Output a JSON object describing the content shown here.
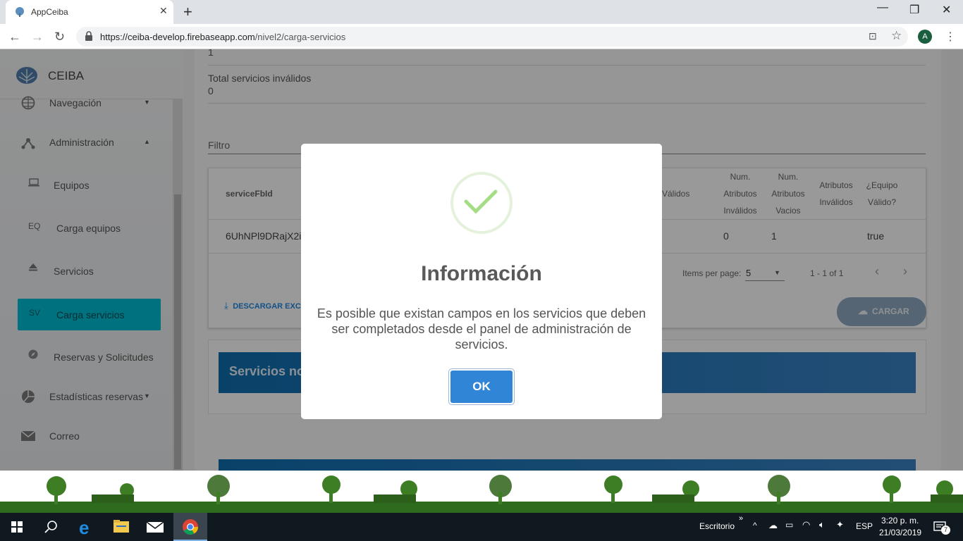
{
  "browser": {
    "tab_title": "AppCeiba",
    "url_host": "https://ceiba-develop.firebaseapp.com",
    "url_path": "/nivel2/carga-servicios",
    "avatar_letter": "A"
  },
  "sidebar": {
    "brand": "CEIBA",
    "items": [
      {
        "label": "Navegación",
        "icon": "globe-icon"
      },
      {
        "label": "Administración",
        "icon": "network-icon"
      },
      {
        "abbr": "",
        "label": "Equipos",
        "icon": "laptop-icon"
      },
      {
        "abbr": "EQ",
        "label": "Carga equipos"
      },
      {
        "abbr": "",
        "label": "Servicios",
        "icon": "eject-icon"
      },
      {
        "abbr": "SV",
        "label": "Carga servicios",
        "active": true
      },
      {
        "abbr": "",
        "label": "Reservas y Solicitudes",
        "icon": "compass-icon"
      },
      {
        "label": "Estadísticas reservas",
        "icon": "pie-chart-icon"
      },
      {
        "label": "Correo",
        "icon": "mail-icon"
      }
    ]
  },
  "main": {
    "partial_value": "1",
    "total_invalid_label": "Total servicios inválidos",
    "total_invalid_value": "0",
    "filter_label": "Filtro",
    "table": {
      "headers": {
        "service_id": "serviceFbId",
        "validos": "Válidos",
        "num_invalidos": "Num. Atributos Inválidos",
        "num_vacios": "Num. Atributos Vacios",
        "atributos_invalidos": "Atributos Inválidos",
        "equipo_valido": "¿Equipo Válido?"
      },
      "rows": [
        {
          "service_id": "6UhNPl9DRajX2iF",
          "num_invalidos": "0",
          "num_vacios": "1",
          "equipo_valido": "true"
        }
      ],
      "items_per_page_label": "Items per page:",
      "items_per_page_value": "5",
      "range_label": "1 - 1 of 1"
    },
    "download_label": "DESCARGAR EXCE",
    "upload_label": "CARGAR",
    "banner_label": "Servicios no"
  },
  "modal": {
    "title": "Información",
    "message": "Es posible que existan campos en los servicios que deben ser completados desde el panel de administración de servicios.",
    "ok_label": "OK"
  },
  "taskbar": {
    "desktop_label": "Escritorio",
    "language": "ESP",
    "time": "3:20 p. m.",
    "date": "21/03/2019",
    "notification_count": "7"
  },
  "colors": {
    "active_item": "#00bcd4",
    "ok_button": "#3085d6",
    "banner": "#0e6fb0",
    "success_check": "#a5dc86"
  }
}
